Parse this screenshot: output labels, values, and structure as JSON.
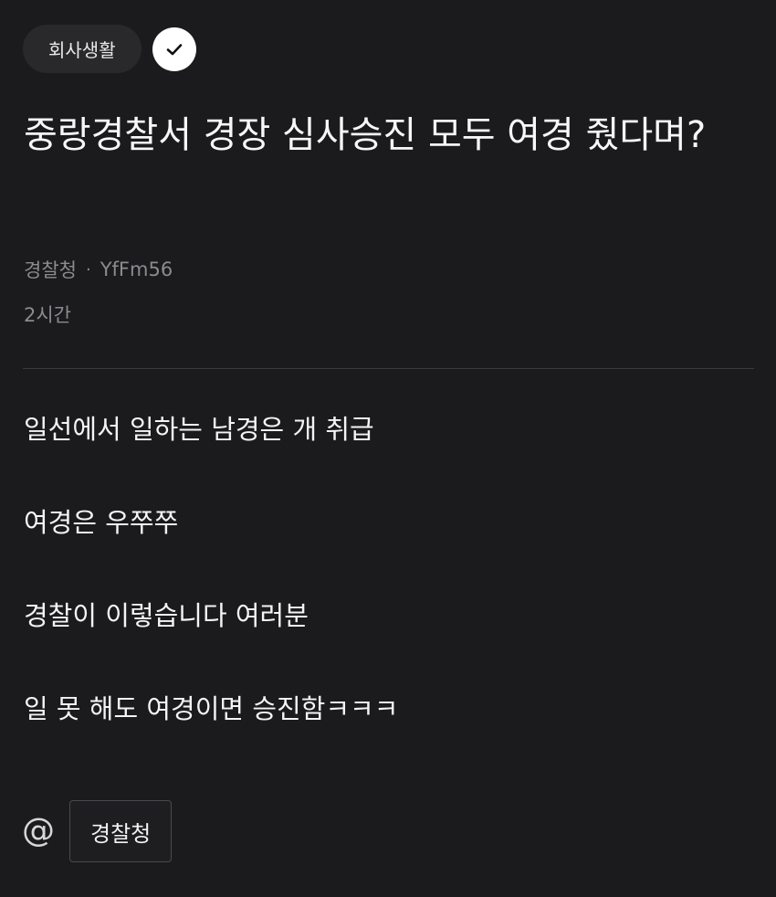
{
  "post": {
    "category": "회사생활",
    "title": "중랑경찰서 경장 심사승진 모두 여경 줬다며?",
    "organization": "경찰청",
    "separator": "·",
    "author_id": "YfFm56",
    "time_ago": "2시간",
    "body_lines": [
      "일선에서 일하는 남경은 개 취급",
      "여경은 우쭈쭈",
      "경찰이 이렇습니다 여러분",
      "일 못 해도 여경이면 승진함ㅋㅋㅋ"
    ],
    "mention": {
      "symbol": "@",
      "tag": "경찰청"
    }
  },
  "icons": {
    "verified": "check-circle-icon",
    "mention": "at-icon"
  },
  "colors": {
    "background": "#1b1b1d",
    "chip_background": "#29292c",
    "text_primary": "#f4f4f4",
    "text_secondary": "#8b8b8f",
    "divider": "#3a3a3d"
  }
}
